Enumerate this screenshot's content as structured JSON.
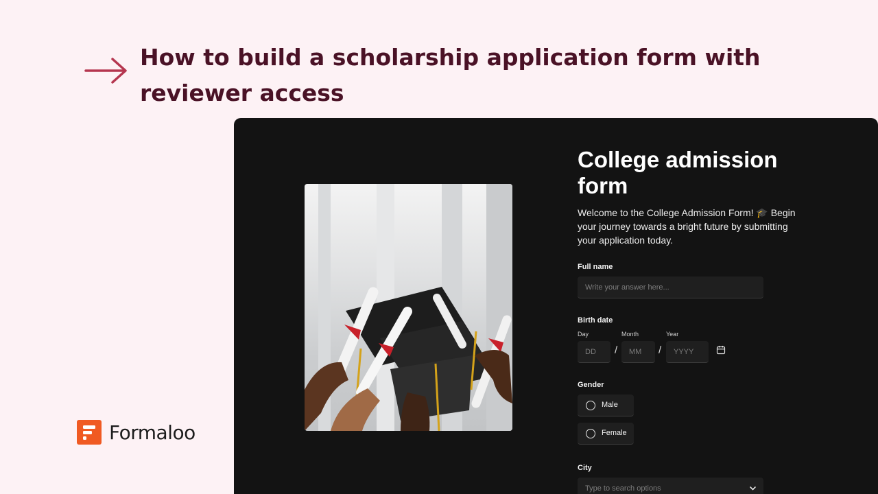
{
  "headline": "How to build a scholarship application form with reviewer access",
  "brand": {
    "name": "Formaloo"
  },
  "form": {
    "title": "College admission form",
    "description": "Welcome to the College Admission Form! 🎓 Begin your journey towards a bright future by submitting your application today.",
    "full_name": {
      "label": "Full name",
      "placeholder": "Write your answer here..."
    },
    "birth_date": {
      "label": "Birth date",
      "day_label": "Day",
      "day_placeholder": "DD",
      "month_label": "Month",
      "month_placeholder": "MM",
      "year_label": "Year",
      "year_placeholder": "YYYY",
      "separator": "/"
    },
    "gender": {
      "label": "Gender",
      "options": [
        "Male",
        "Female"
      ]
    },
    "city": {
      "label": "City",
      "placeholder": "Type to search options"
    }
  },
  "colors": {
    "page_background": "#fdf2f5",
    "headline": "#4a1226",
    "arrow": "#b5364f",
    "brand_orange": "#f05a22",
    "window_background": "#131313"
  },
  "icons": [
    "arrow-right-icon",
    "formaloo-logo-icon",
    "calendar-icon",
    "chevron-down-icon",
    "radio-icon"
  ]
}
